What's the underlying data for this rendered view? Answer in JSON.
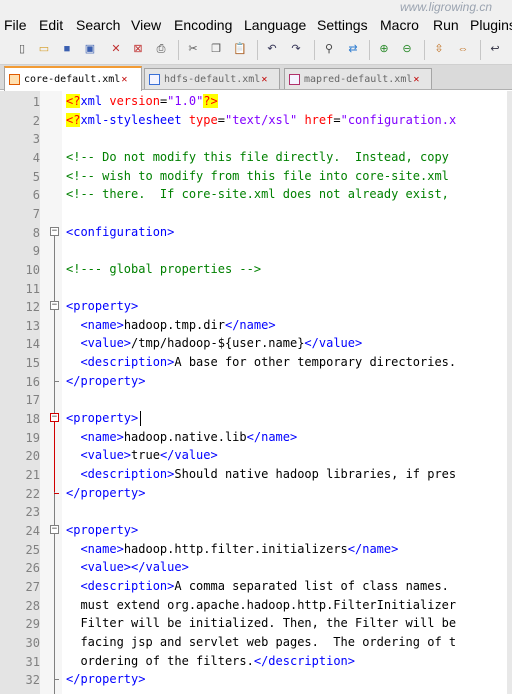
{
  "watermark": "www.ligrowing.cn",
  "menu": [
    "File",
    "Edit",
    "Search",
    "View",
    "Encoding",
    "Language",
    "Settings",
    "Macro",
    "Run",
    "Plugins"
  ],
  "toolbar_icons": [
    "new-file-icon",
    "open-file-icon",
    "save-icon",
    "save-all-icon",
    "close-icon",
    "close-all-icon",
    "print-icon",
    "cut-icon",
    "copy-icon",
    "paste-icon",
    "undo-icon",
    "redo-icon",
    "find-icon",
    "replace-icon",
    "zoom-in-icon",
    "zoom-out-icon",
    "sync-vertical-icon",
    "sync-horizontal-icon",
    "word-wrap-icon"
  ],
  "tabs": [
    {
      "label": "core-default.xml",
      "active": true,
      "icon_color": "#e05a00"
    },
    {
      "label": "hdfs-default.xml",
      "active": false,
      "icon_color": "#3a6fd6"
    },
    {
      "label": "mapred-default.xml",
      "active": false,
      "icon_color": "#b0306a"
    }
  ],
  "lines": [
    {
      "n": "1",
      "segs": [
        [
          "pi",
          "<?"
        ],
        [
          "tag",
          "xml "
        ],
        [
          "attr",
          "version"
        ],
        [
          "text",
          "="
        ],
        [
          "val",
          "\"1.0\""
        ],
        [
          "pi",
          "?>"
        ]
      ]
    },
    {
      "n": "2",
      "segs": [
        [
          "pi",
          "<?"
        ],
        [
          "tag",
          "xml-stylesheet "
        ],
        [
          "attr",
          "type"
        ],
        [
          "text",
          "="
        ],
        [
          "val",
          "\"text/xsl\""
        ],
        [
          "text",
          " "
        ],
        [
          "attr",
          "href"
        ],
        [
          "text",
          "="
        ],
        [
          "val",
          "\"configuration.x"
        ]
      ]
    },
    {
      "n": "3",
      "segs": []
    },
    {
      "n": "4",
      "segs": [
        [
          "comment",
          "<!-- Do not modify this file directly.  Instead, copy"
        ]
      ]
    },
    {
      "n": "5",
      "segs": [
        [
          "comment",
          "<!-- wish to modify from this file into core-site.xml"
        ]
      ]
    },
    {
      "n": "6",
      "segs": [
        [
          "comment",
          "<!-- there.  If core-site.xml does not already exist,"
        ]
      ]
    },
    {
      "n": "7",
      "segs": []
    },
    {
      "n": "8",
      "segs": [
        [
          "tag",
          "<configuration>"
        ]
      ]
    },
    {
      "n": "9",
      "segs": []
    },
    {
      "n": "10",
      "segs": [
        [
          "comment",
          "<!--- global properties -->"
        ]
      ]
    },
    {
      "n": "11",
      "segs": []
    },
    {
      "n": "12",
      "segs": [
        [
          "tag",
          "<property>"
        ]
      ]
    },
    {
      "n": "13",
      "segs": [
        [
          "text",
          "  "
        ],
        [
          "tag",
          "<name>"
        ],
        [
          "text",
          "hadoop.tmp.dir"
        ],
        [
          "tag",
          "</name>"
        ]
      ]
    },
    {
      "n": "14",
      "segs": [
        [
          "text",
          "  "
        ],
        [
          "tag",
          "<value>"
        ],
        [
          "text",
          "/tmp/hadoop-${user.name}"
        ],
        [
          "tag",
          "</value>"
        ]
      ]
    },
    {
      "n": "15",
      "segs": [
        [
          "text",
          "  "
        ],
        [
          "tag",
          "<description>"
        ],
        [
          "text",
          "A base for other temporary directories."
        ]
      ]
    },
    {
      "n": "16",
      "segs": [
        [
          "tag",
          "</property>"
        ]
      ]
    },
    {
      "n": "17",
      "segs": []
    },
    {
      "n": "18",
      "segs": [
        [
          "tag",
          "<property>"
        ]
      ]
    },
    {
      "n": "19",
      "segs": [
        [
          "text",
          "  "
        ],
        [
          "tag",
          "<name>"
        ],
        [
          "text",
          "hadoop.native.lib"
        ],
        [
          "tag",
          "</name>"
        ]
      ]
    },
    {
      "n": "20",
      "segs": [
        [
          "text",
          "  "
        ],
        [
          "tag",
          "<value>"
        ],
        [
          "text",
          "true"
        ],
        [
          "tag",
          "</value>"
        ]
      ]
    },
    {
      "n": "21",
      "segs": [
        [
          "text",
          "  "
        ],
        [
          "tag",
          "<description>"
        ],
        [
          "text",
          "Should native hadoop libraries, if pres"
        ]
      ]
    },
    {
      "n": "22",
      "segs": [
        [
          "tag",
          "</property>"
        ]
      ]
    },
    {
      "n": "23",
      "segs": []
    },
    {
      "n": "24",
      "segs": [
        [
          "tag",
          "<property>"
        ]
      ]
    },
    {
      "n": "25",
      "segs": [
        [
          "text",
          "  "
        ],
        [
          "tag",
          "<name>"
        ],
        [
          "text",
          "hadoop.http.filter.initializers"
        ],
        [
          "tag",
          "</name>"
        ]
      ]
    },
    {
      "n": "26",
      "segs": [
        [
          "text",
          "  "
        ],
        [
          "tag",
          "<value></value>"
        ]
      ]
    },
    {
      "n": "27",
      "segs": [
        [
          "text",
          "  "
        ],
        [
          "tag",
          "<description>"
        ],
        [
          "text",
          "A comma separated list of class names."
        ]
      ]
    },
    {
      "n": "28",
      "segs": [
        [
          "text",
          "  must extend org.apache.hadoop.http.FilterInitializer"
        ]
      ]
    },
    {
      "n": "29",
      "segs": [
        [
          "text",
          "  Filter will be initialized. Then, the Filter will be"
        ]
      ]
    },
    {
      "n": "30",
      "segs": [
        [
          "text",
          "  facing jsp and servlet web pages.  The ordering of t"
        ]
      ]
    },
    {
      "n": "31",
      "segs": [
        [
          "text",
          "  ordering of the filters."
        ],
        [
          "tag",
          "</description>"
        ]
      ]
    },
    {
      "n": "32",
      "segs": [
        [
          "tag",
          "</property>"
        ]
      ]
    }
  ]
}
